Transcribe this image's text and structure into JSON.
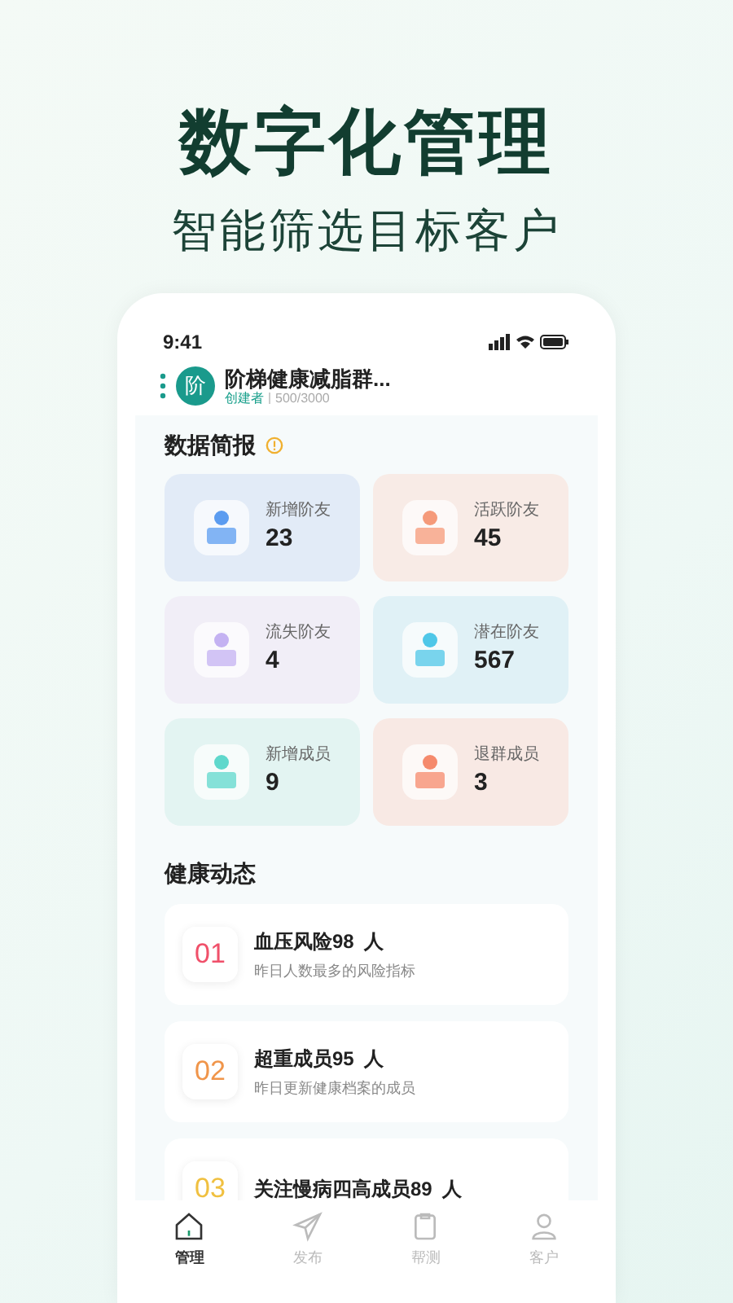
{
  "headline": "数字化管理",
  "subheadline": "智能筛选目标客户",
  "status_bar": {
    "time": "9:41"
  },
  "group": {
    "avatar": "阶",
    "name": "阶梯健康减脂群...",
    "role": "创建者",
    "members": "500/3000"
  },
  "summary": {
    "title": "数据简报",
    "stats": [
      {
        "label": "新增阶友",
        "value": "23",
        "color": "#5b9cf0"
      },
      {
        "label": "活跃阶友",
        "value": "45",
        "color": "#f59a7a"
      },
      {
        "label": "流失阶友",
        "value": "4",
        "color": "#c4b2f2"
      },
      {
        "label": "潜在阶友",
        "value": "567",
        "color": "#4fc7e8"
      },
      {
        "label": "新增成员",
        "value": "9",
        "color": "#5fd8cc"
      },
      {
        "label": "退群成员",
        "value": "3",
        "color": "#f58a6c"
      }
    ]
  },
  "health": {
    "title": "健康动态",
    "items": [
      {
        "rank": "01",
        "color": "#f0506a",
        "title": "血压风险",
        "count": "98",
        "unit": "人",
        "subtitle": "昨日人数最多的风险指标"
      },
      {
        "rank": "02",
        "color": "#f0954a",
        "title": "超重成员",
        "count": "95",
        "unit": "人",
        "subtitle": "昨日更新健康档案的成员"
      },
      {
        "rank": "03",
        "color": "#f0c040",
        "title": "关注慢病四高成员",
        "count": "89",
        "unit": "人"
      }
    ]
  },
  "nav": [
    {
      "label": "管理",
      "selected": true
    },
    {
      "label": "发布",
      "selected": false
    },
    {
      "label": "帮测",
      "selected": false
    },
    {
      "label": "客户",
      "selected": false
    }
  ]
}
